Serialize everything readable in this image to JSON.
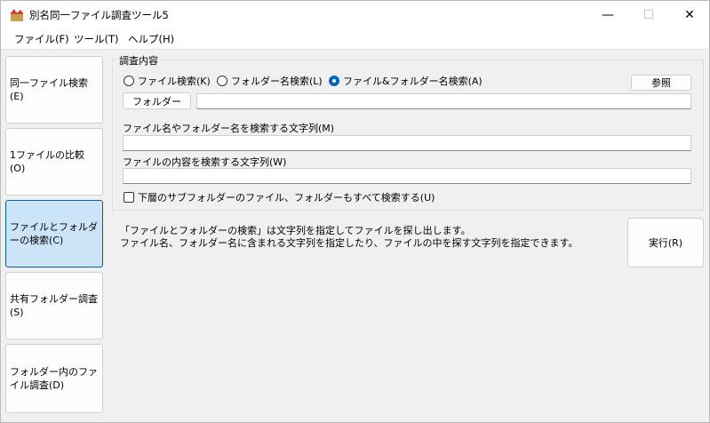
{
  "window": {
    "title": "別名同一ファイル調査ツール5",
    "controls": {
      "minimize": "—",
      "maximize": "☐",
      "close": "✕"
    }
  },
  "menu": [
    {
      "label": "ファイル(F)"
    },
    {
      "label": "ツール(T)"
    },
    {
      "label": "ヘルプ(H)"
    }
  ],
  "nav": [
    {
      "label": "同一ファイル検索(E)"
    },
    {
      "label": "1ファイルの比較(O)"
    },
    {
      "label": "ファイルとフォルダーの検索(C)"
    },
    {
      "label": "共有フォルダー調査(S)"
    },
    {
      "label": "フォルダー内のファイル調査(D)"
    }
  ],
  "group": {
    "label": "調査内容"
  },
  "radios": [
    {
      "label": "ファイル検索(K)",
      "checked": false
    },
    {
      "label": "フォルダー名検索(L)",
      "checked": false
    },
    {
      "label": "ファイル&フォルダー名検索(A)",
      "checked": true
    }
  ],
  "browse_button": "参照",
  "folder_button": "フォルダー",
  "folder_input": {
    "value": ""
  },
  "name_search": {
    "label": "ファイル名やフォルダー名を検索する文字列(M)",
    "value": ""
  },
  "content_search": {
    "label": "ファイルの内容を検索する文字列(W)",
    "value": ""
  },
  "subfolder_checkbox": {
    "label": "下層のサブフォルダーのファイル、フォルダーもすべて検索する(U)",
    "checked": false
  },
  "description": {
    "line1": "「ファイルとフォルダーの検索」は文字列を指定してファイルを探し出します。",
    "line2": "ファイル名、フォルダー名に含まれる文字列を指定したり、ファイルの中を探す文字列を指定できます。"
  },
  "run_button": "実行(R)"
}
